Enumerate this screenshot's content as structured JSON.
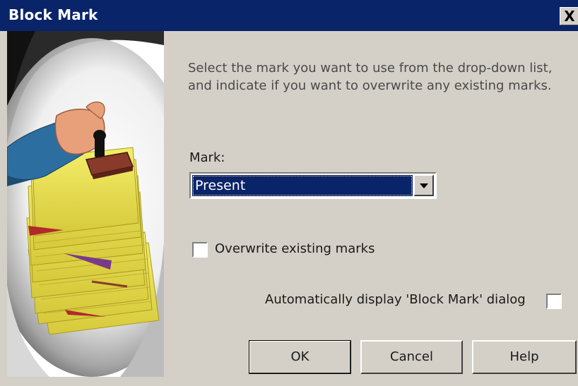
{
  "window": {
    "title": "Block Mark",
    "close_label": "X"
  },
  "illustration": {
    "icon": "hand-stamping-papers-image"
  },
  "content": {
    "instructions": "Select the mark you want to use from the drop-down list, and indicate if you want to overwrite any existing marks.",
    "mark_label": "Mark:",
    "mark_select": {
      "value": "Present",
      "icon": "chevron-down-icon"
    },
    "overwrite_checkbox": {
      "label": "Overwrite existing marks",
      "checked": false
    },
    "auto_display_checkbox": {
      "label": "Automatically display 'Block Mark' dialog",
      "checked": false
    }
  },
  "buttons": {
    "ok": "OK",
    "cancel": "Cancel",
    "help": "Help"
  },
  "colors": {
    "titlebar": "#0a246a",
    "dialog_bg": "#d4d0c8",
    "selection": "#0a246a"
  }
}
